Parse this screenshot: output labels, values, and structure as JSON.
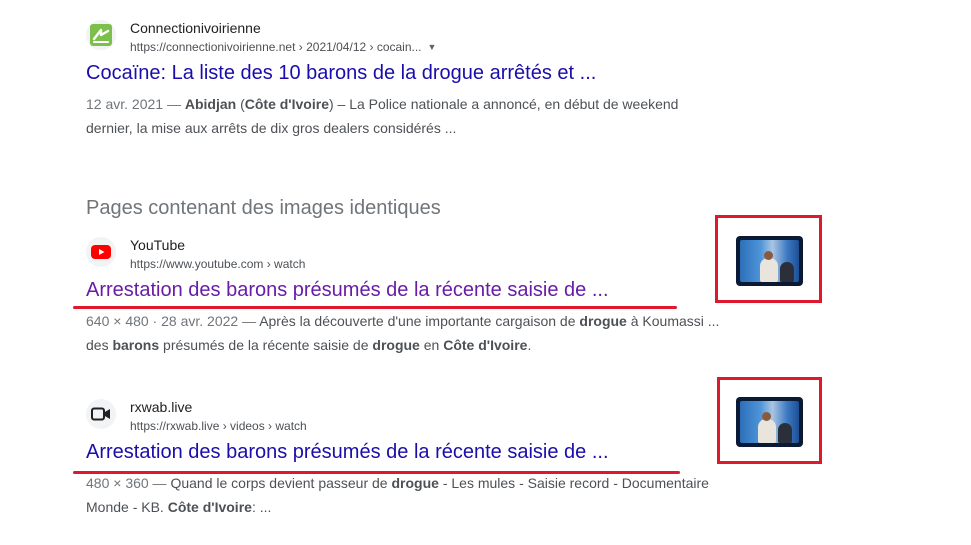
{
  "results": [
    {
      "site_name": "Connectionivoirienne",
      "url": "https://connectionivoirienne.net › 2021/04/12 › cocain...",
      "favicon": "connectionivoirienne-logo-icon",
      "title": "Cocaïne: La liste des 10 barons de la drogue arrêtés et ...",
      "snippet": {
        "date": "12 avr. 2021 — ",
        "b1": "Abidjan",
        "t1": " (",
        "b2": "Côte d'Ivoire",
        "t2": ") – La Police nationale a annoncé, en début de weekend dernier, la mise aux arrêts de dix gros dealers considérés ..."
      }
    },
    {
      "site_name": "YouTube",
      "url": "https://www.youtube.com › watch",
      "favicon": "youtube-play-icon",
      "title": "Arrestation des barons présumés de la récente saisie de ...",
      "snippet": {
        "date": "640 × 480 · 28 avr. 2022 — ",
        "t1": "Après la découverte d'une importante cargaison de ",
        "b1": "drogue",
        "t2": " à Koumassi ... des ",
        "b2": "barons",
        "t3": " présumés de la récente saisie de ",
        "b3": "drogue",
        "t4": " en ",
        "b4": "Côte d'Ivoire",
        "t5": "."
      }
    },
    {
      "site_name": "rxwab.live",
      "url": "https://rxwab.live › videos › watch",
      "favicon": "video-camera-icon",
      "title": "Arrestation des barons présumés de la récente saisie de ...",
      "snippet": {
        "date": "480 × 360 — ",
        "t1": "Quand le corps devient passeur de ",
        "b1": "drogue",
        "t2": " - Les mules - Saisie record - Documentaire Monde - KB. ",
        "b2": "Côte d'Ivoire",
        "t3": ": ..."
      }
    }
  ],
  "section_heading": "Pages contenant des images identiques",
  "colors": {
    "link": "#1a0dab",
    "visited_link": "#681da8",
    "highlight": "#e0182d",
    "text_muted": "#4d5156"
  },
  "icons": [
    "chevron-down-icon",
    "connectionivoirienne-logo-icon",
    "youtube-play-icon",
    "video-camera-icon"
  ]
}
